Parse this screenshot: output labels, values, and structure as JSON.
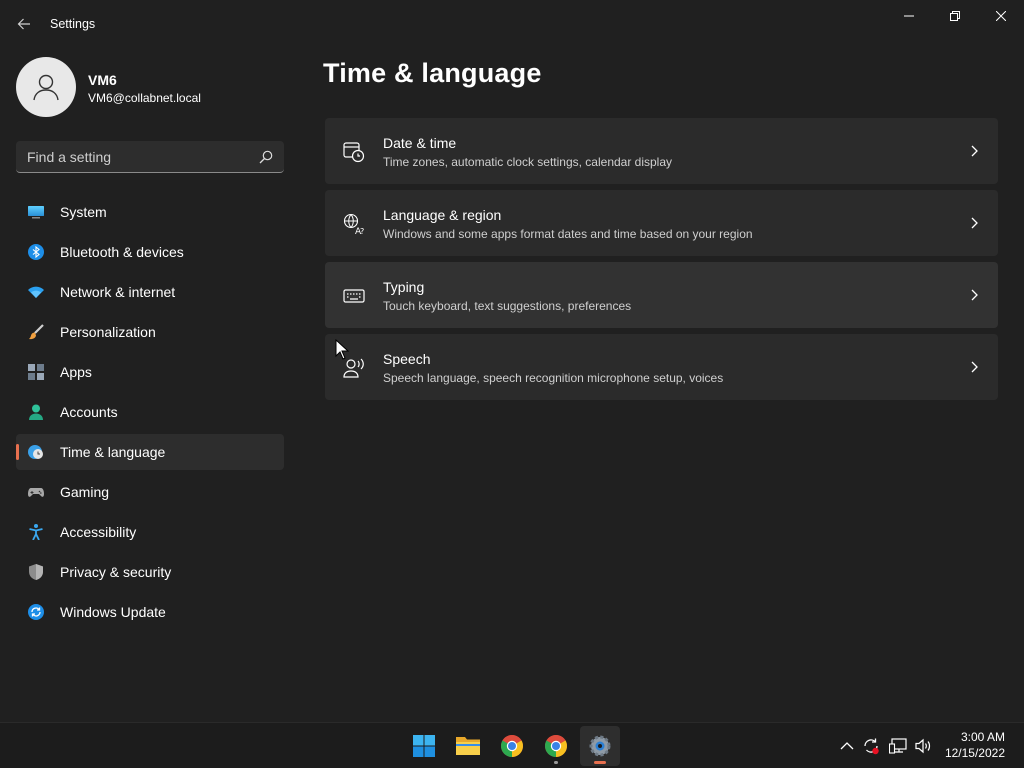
{
  "app": {
    "title": "Settings"
  },
  "user": {
    "name": "VM6",
    "email": "VM6@collabnet.local"
  },
  "search": {
    "placeholder": "Find a setting"
  },
  "nav": {
    "items": [
      {
        "label": "System",
        "icon": "system-icon"
      },
      {
        "label": "Bluetooth & devices",
        "icon": "bluetooth-icon"
      },
      {
        "label": "Network & internet",
        "icon": "wifi-icon"
      },
      {
        "label": "Personalization",
        "icon": "brush-icon"
      },
      {
        "label": "Apps",
        "icon": "apps-icon"
      },
      {
        "label": "Accounts",
        "icon": "accounts-icon"
      },
      {
        "label": "Time & language",
        "icon": "time-language-icon",
        "selected": true
      },
      {
        "label": "Gaming",
        "icon": "gamepad-icon"
      },
      {
        "label": "Accessibility",
        "icon": "accessibility-icon"
      },
      {
        "label": "Privacy & security",
        "icon": "shield-icon"
      },
      {
        "label": "Windows Update",
        "icon": "update-icon"
      }
    ]
  },
  "main": {
    "title": "Time & language",
    "cards": [
      {
        "title": "Date & time",
        "description": "Time zones, automatic clock settings, calendar display",
        "icon": "calendar-clock-icon"
      },
      {
        "title": "Language & region",
        "description": "Windows and some apps format dates and time based on your region",
        "icon": "language-icon"
      },
      {
        "title": "Typing",
        "description": "Touch keyboard, text suggestions, preferences",
        "icon": "keyboard-icon"
      },
      {
        "title": "Speech",
        "description": "Speech language, speech recognition microphone setup, voices",
        "icon": "speech-icon"
      }
    ]
  },
  "taskbar": {
    "apps": [
      "start-icon",
      "file-explorer-icon",
      "chrome-icon",
      "chrome-icon",
      "settings-icon"
    ],
    "clock": {
      "time": "3:00 AM",
      "date": "12/15/2022"
    }
  },
  "colors": {
    "accent": "#e8704f",
    "background": "#202020",
    "card": "#2b2b2b"
  }
}
